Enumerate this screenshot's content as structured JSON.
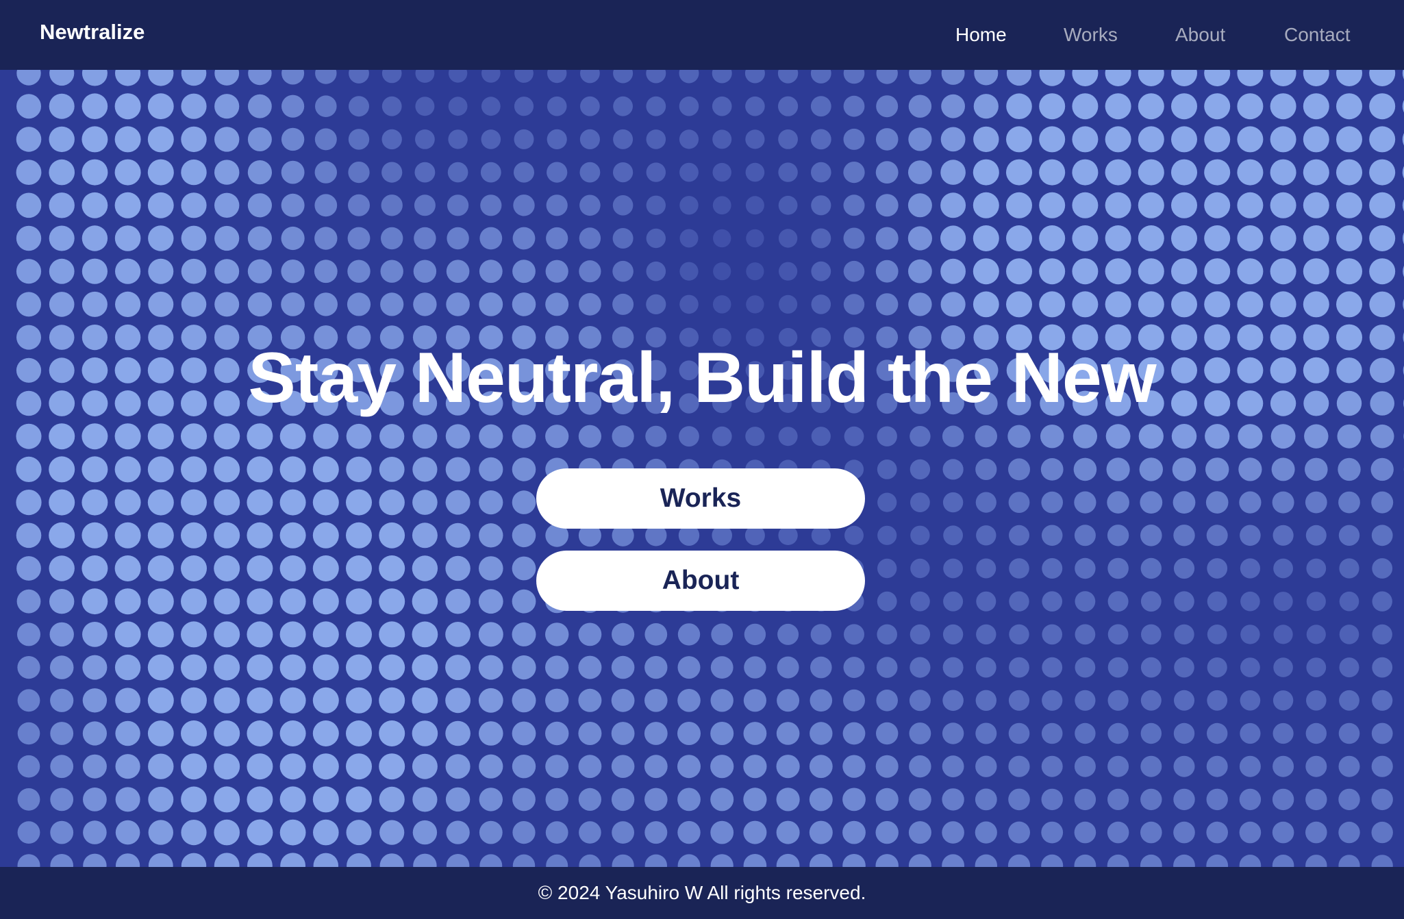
{
  "nav": {
    "brand": "Newtralize",
    "links": [
      {
        "label": "Home",
        "active": true
      },
      {
        "label": "Works",
        "active": false
      },
      {
        "label": "About",
        "active": false
      },
      {
        "label": "Contact",
        "active": false
      }
    ]
  },
  "hero": {
    "headline": "Stay Neutral, Build the New",
    "buttons": [
      {
        "label": "Works"
      },
      {
        "label": "About"
      }
    ]
  },
  "footer": {
    "text": "© 2024 Yasuhiro W All rights reserved."
  },
  "colors": {
    "nav_background": "#1a2456",
    "hero_background": "#2d3b96",
    "dot_light": "#8aa8ea",
    "dot_dark": "#3e4ea8",
    "button_background": "#ffffff",
    "button_text": "#1a2456"
  }
}
